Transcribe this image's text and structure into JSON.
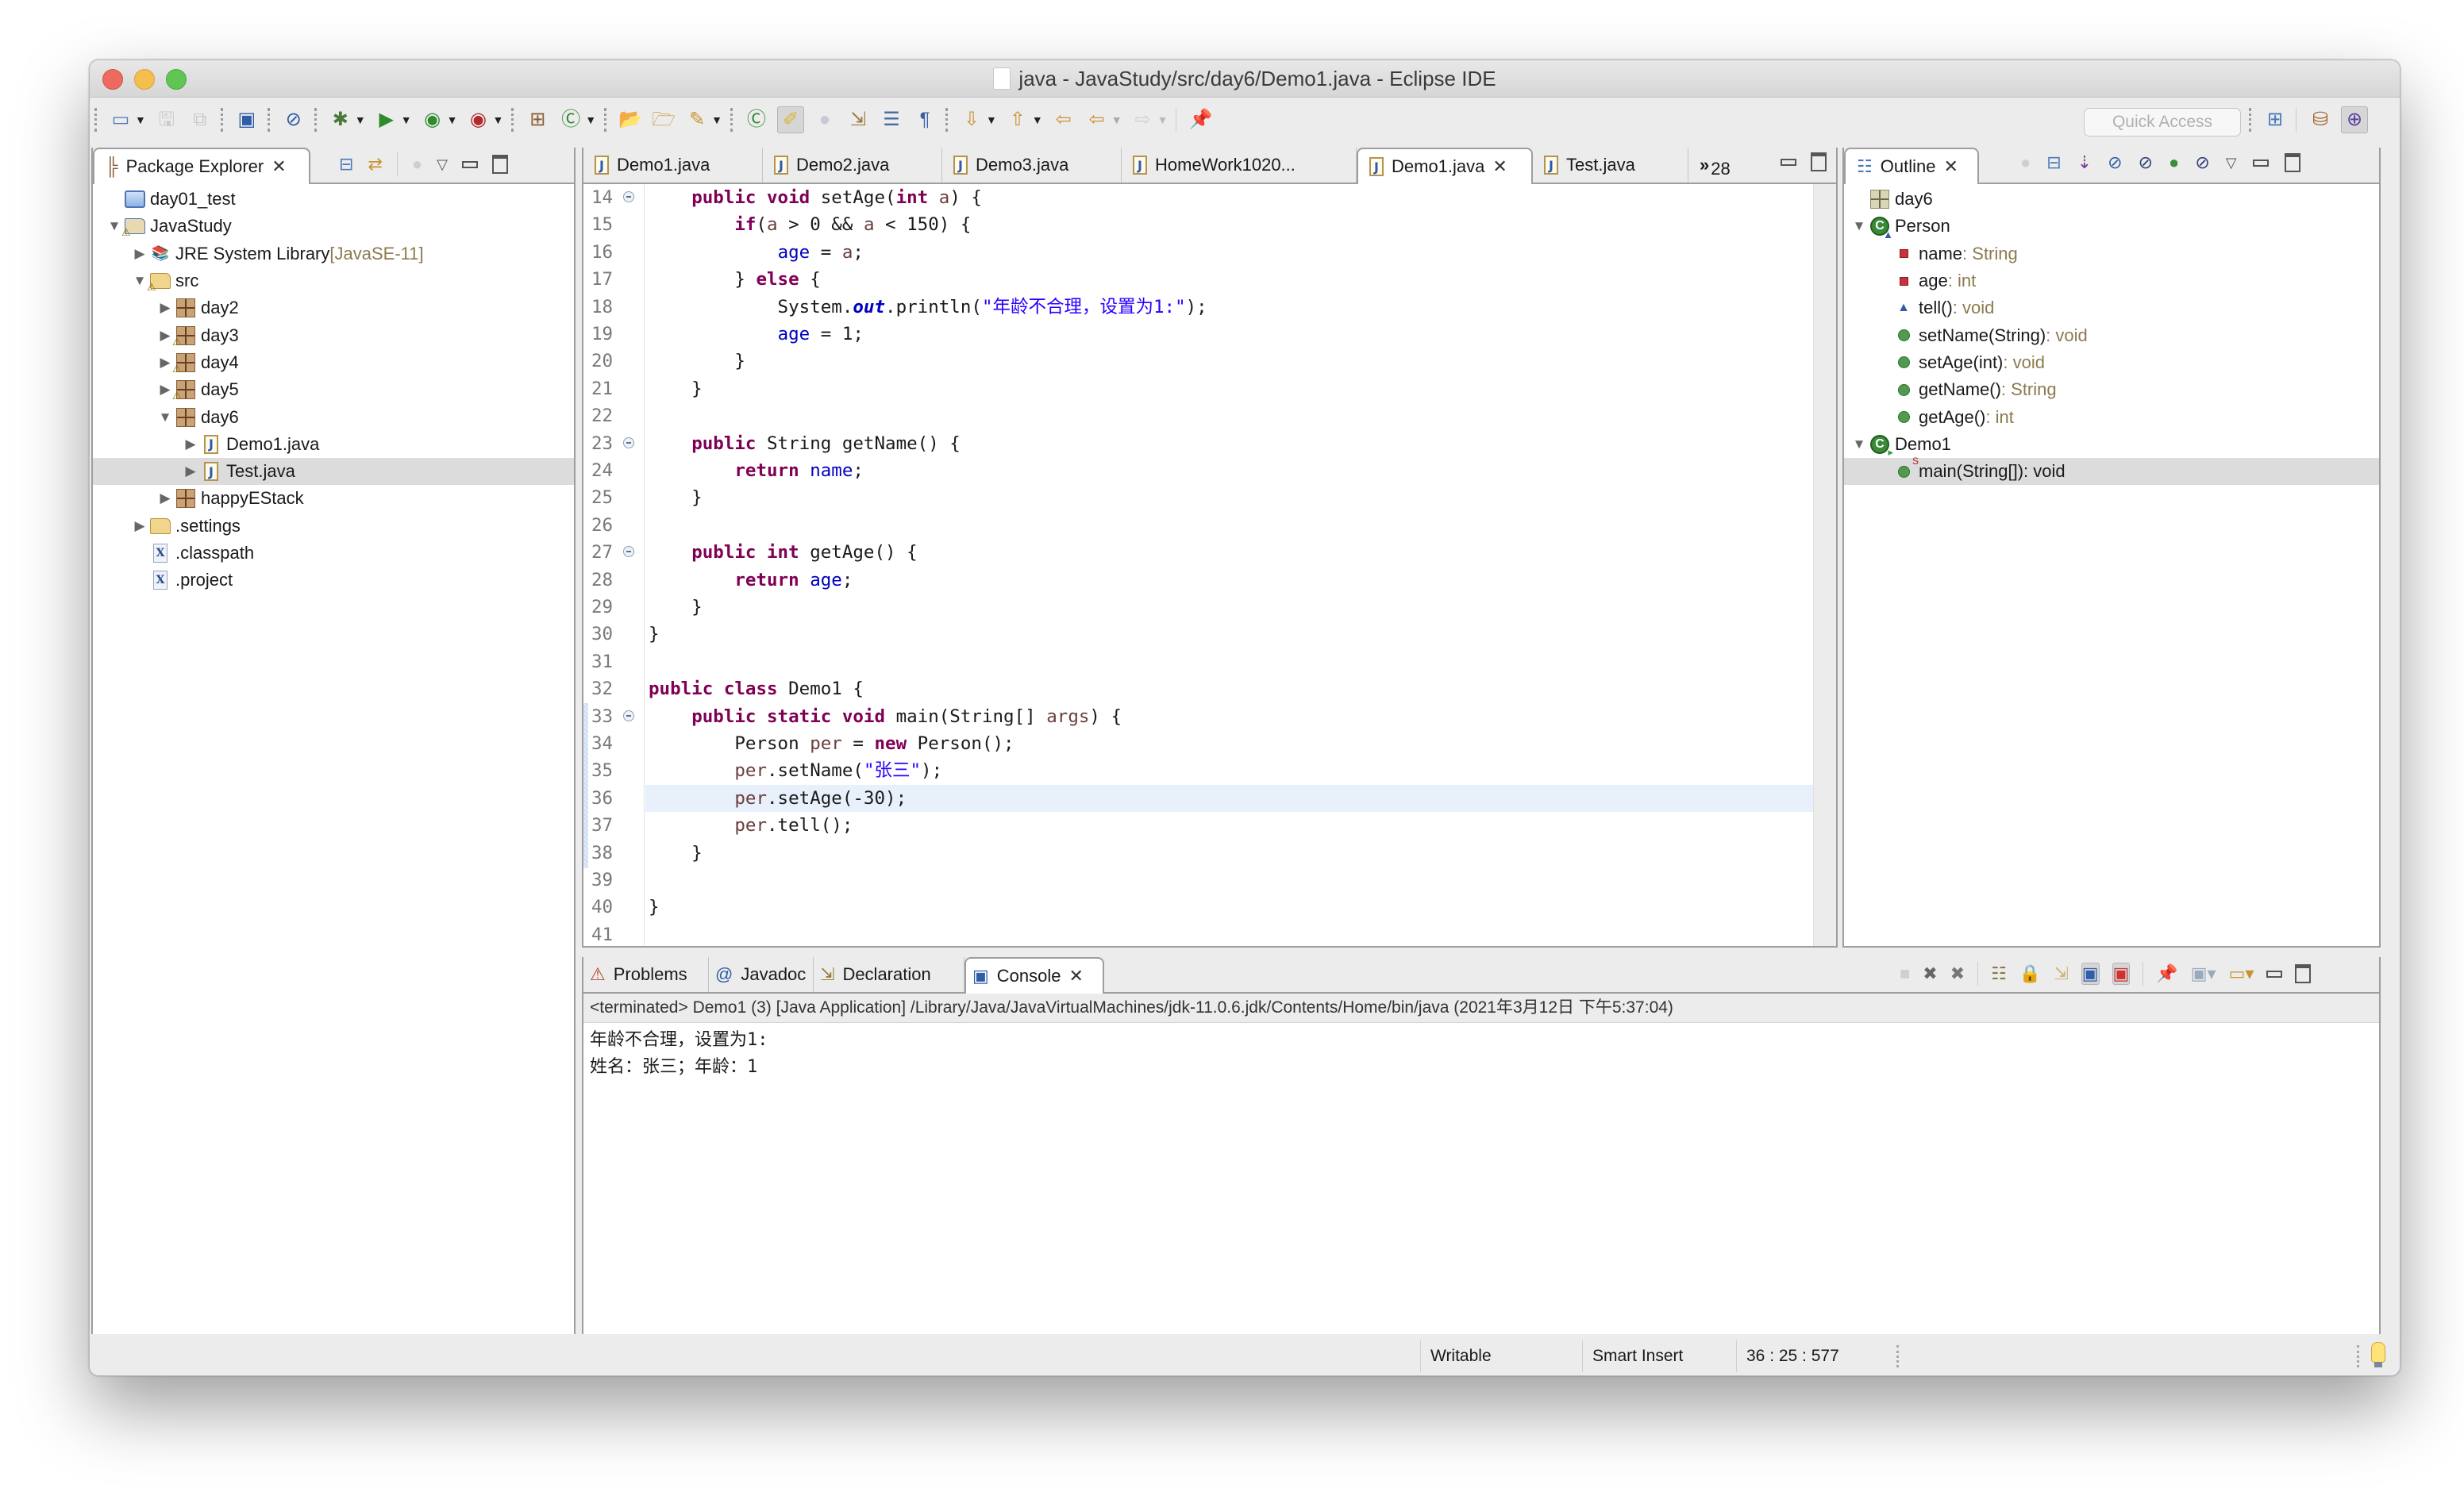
{
  "window": {
    "title": "java - JavaStudy/src/day6/Demo1.java - Eclipse IDE"
  },
  "toolbar": {
    "icons": [
      "new-wizard-icon",
      "save-icon",
      "save-all-icon",
      "console-icon",
      "skip-breakpoints-icon",
      "debug-icon",
      "run-icon",
      "coverage-icon",
      "external-tools-icon",
      "new-package-icon",
      "new-class-icon",
      "open-type-icon",
      "open-task-icon",
      "search-icon",
      "open-perspective-class-icon",
      "toggle-mark-occurrences-icon",
      "toggle-ws-icon",
      "toggle-block-icon",
      "show-whitespace-icon",
      "next-annotation-icon",
      "previous-annotation-icon",
      "last-edit-icon",
      "back-icon",
      "forward-icon",
      "pin-editor-icon"
    ],
    "quick_access_placeholder": "Quick Access",
    "perspectives": [
      "open-perspective-icon",
      "java-ee-perspective-icon",
      "java-perspective-icon"
    ]
  },
  "package_explorer": {
    "tab_label": "Package Explorer",
    "items": [
      {
        "label": "day01_test",
        "icon": "closed-project-icon",
        "depth": 0,
        "expander": "none"
      },
      {
        "label": "JavaStudy",
        "icon": "java-project-icon",
        "depth": 0,
        "expander": "expanded",
        "warning": true
      },
      {
        "label": "JRE System Library",
        "decoration": "[JavaSE-11]",
        "icon": "library-icon",
        "depth": 1,
        "expander": "collapsed"
      },
      {
        "label": "src",
        "icon": "source-folder-icon",
        "depth": 1,
        "expander": "expanded",
        "warning": true
      },
      {
        "label": "day2",
        "icon": "package-icon",
        "depth": 2,
        "expander": "collapsed"
      },
      {
        "label": "day3",
        "icon": "package-icon",
        "depth": 2,
        "expander": "collapsed",
        "warning": true
      },
      {
        "label": "day4",
        "icon": "package-icon",
        "depth": 2,
        "expander": "collapsed",
        "warning": true
      },
      {
        "label": "day5",
        "icon": "package-icon",
        "depth": 2,
        "expander": "collapsed",
        "warning": true
      },
      {
        "label": "day6",
        "icon": "package-icon",
        "depth": 2,
        "expander": "expanded"
      },
      {
        "label": "Demo1.java",
        "icon": "java-file-icon",
        "depth": 3,
        "expander": "collapsed"
      },
      {
        "label": "Test.java",
        "icon": "java-file-icon",
        "depth": 3,
        "expander": "collapsed",
        "selected": true
      },
      {
        "label": "happyEStack",
        "icon": "package-icon",
        "depth": 2,
        "expander": "collapsed"
      },
      {
        "label": ".settings",
        "icon": "folder-icon",
        "depth": 1,
        "expander": "collapsed"
      },
      {
        "label": ".classpath",
        "icon": "xml-file-icon",
        "depth": 1,
        "expander": "none"
      },
      {
        "label": ".project",
        "icon": "xml-file-icon",
        "depth": 1,
        "expander": "none"
      }
    ]
  },
  "editor": {
    "tabs": [
      {
        "label": "Demo1.java"
      },
      {
        "label": "Demo2.java"
      },
      {
        "label": "Demo3.java"
      },
      {
        "label": "HomeWork1020..."
      },
      {
        "label": "Demo1.java",
        "active": true
      },
      {
        "label": "Test.java"
      }
    ],
    "overflow_count": "28",
    "current_line": 36,
    "lines": [
      {
        "n": "14",
        "fold": true,
        "tokens": [
          [
            "",
            "    "
          ],
          [
            "k",
            "public"
          ],
          [
            "",
            " "
          ],
          [
            "k",
            "void"
          ],
          [
            "",
            " setAge("
          ],
          [
            "k",
            "int"
          ],
          [
            "",
            " "
          ],
          [
            "lv",
            "a"
          ],
          [
            "",
            ") {"
          ]
        ]
      },
      {
        "n": "15",
        "tokens": [
          [
            "",
            "        "
          ],
          [
            "k",
            "if"
          ],
          [
            "",
            "("
          ],
          [
            "lv",
            "a"
          ],
          [
            "",
            " > 0 && "
          ],
          [
            "lv",
            "a"
          ],
          [
            "",
            " < 150) {"
          ]
        ]
      },
      {
        "n": "16",
        "tokens": [
          [
            "",
            "            "
          ],
          [
            "f",
            "age"
          ],
          [
            "",
            " = "
          ],
          [
            "lv",
            "a"
          ],
          [
            "",
            ";"
          ]
        ]
      },
      {
        "n": "17",
        "tokens": [
          [
            "",
            "        } "
          ],
          [
            "k",
            "else"
          ],
          [
            "",
            " {"
          ]
        ]
      },
      {
        "n": "18",
        "tokens": [
          [
            "",
            "            System."
          ],
          [
            "fs",
            "out"
          ],
          [
            "",
            ".println("
          ],
          [
            "s",
            "\"年龄不合理，设置为1:\""
          ],
          [
            "",
            ");"
          ]
        ]
      },
      {
        "n": "19",
        "tokens": [
          [
            "",
            "            "
          ],
          [
            "f",
            "age"
          ],
          [
            "",
            " = 1;"
          ]
        ]
      },
      {
        "n": "20",
        "tokens": [
          [
            "",
            "        }"
          ]
        ]
      },
      {
        "n": "21",
        "tokens": [
          [
            "",
            "    }"
          ]
        ]
      },
      {
        "n": "22",
        "tokens": []
      },
      {
        "n": "23",
        "fold": true,
        "tokens": [
          [
            "",
            "    "
          ],
          [
            "k",
            "public"
          ],
          [
            "",
            " String getName() {"
          ]
        ]
      },
      {
        "n": "24",
        "tokens": [
          [
            "",
            "        "
          ],
          [
            "k",
            "return"
          ],
          [
            "",
            " "
          ],
          [
            "f",
            "name"
          ],
          [
            "",
            ";"
          ]
        ]
      },
      {
        "n": "25",
        "tokens": [
          [
            "",
            "    }"
          ]
        ]
      },
      {
        "n": "26",
        "tokens": []
      },
      {
        "n": "27",
        "fold": true,
        "tokens": [
          [
            "",
            "    "
          ],
          [
            "k",
            "public"
          ],
          [
            "",
            " "
          ],
          [
            "k",
            "int"
          ],
          [
            "",
            " getAge() {"
          ]
        ]
      },
      {
        "n": "28",
        "tokens": [
          [
            "",
            "        "
          ],
          [
            "k",
            "return"
          ],
          [
            "",
            " "
          ],
          [
            "f",
            "age"
          ],
          [
            "",
            ";"
          ]
        ]
      },
      {
        "n": "29",
        "tokens": [
          [
            "",
            "    }"
          ]
        ]
      },
      {
        "n": "30",
        "tokens": [
          [
            "",
            "}"
          ]
        ]
      },
      {
        "n": "31",
        "tokens": []
      },
      {
        "n": "32",
        "tokens": [
          [
            "k",
            "public"
          ],
          [
            "",
            " "
          ],
          [
            "k",
            "class"
          ],
          [
            "",
            " Demo1 {"
          ]
        ]
      },
      {
        "n": "33",
        "fold": true,
        "tokens": [
          [
            "",
            "    "
          ],
          [
            "k",
            "public"
          ],
          [
            "",
            " "
          ],
          [
            "k",
            "static"
          ],
          [
            "",
            " "
          ],
          [
            "k",
            "void"
          ],
          [
            "",
            " main(String[] "
          ],
          [
            "lv",
            "args"
          ],
          [
            "",
            ") {"
          ]
        ]
      },
      {
        "n": "34",
        "tokens": [
          [
            "",
            "        Person "
          ],
          [
            "lv",
            "per"
          ],
          [
            "",
            " = "
          ],
          [
            "k",
            "new"
          ],
          [
            "",
            " Person();"
          ]
        ]
      },
      {
        "n": "35",
        "tokens": [
          [
            "",
            "        "
          ],
          [
            "lv",
            "per"
          ],
          [
            "",
            ".setName("
          ],
          [
            "s",
            "\"张三\""
          ],
          [
            "",
            ");"
          ]
        ]
      },
      {
        "n": "36",
        "tokens": [
          [
            "",
            "        "
          ],
          [
            "lv",
            "per"
          ],
          [
            "",
            ".setAge(-30);"
          ]
        ]
      },
      {
        "n": "37",
        "tokens": [
          [
            "",
            "        "
          ],
          [
            "lv",
            "per"
          ],
          [
            "",
            ".tell();"
          ]
        ]
      },
      {
        "n": "38",
        "tokens": [
          [
            "",
            "    }"
          ]
        ]
      },
      {
        "n": "39",
        "tokens": []
      },
      {
        "n": "40",
        "tokens": [
          [
            "",
            "}"
          ]
        ]
      },
      {
        "n": "41",
        "tokens": []
      }
    ]
  },
  "outline": {
    "tab_label": "Outline",
    "items": [
      {
        "label": "day6",
        "type": "",
        "icon": "package-icon",
        "depth": 0,
        "expander": "none"
      },
      {
        "label": "Person",
        "type": "",
        "icon": "class-default-icon",
        "depth": 0,
        "expander": "expanded"
      },
      {
        "label": "name",
        "type": " : String",
        "icon": "private-field-icon",
        "depth": 1
      },
      {
        "label": "age",
        "type": " : int",
        "icon": "private-field-icon",
        "depth": 1
      },
      {
        "label": "tell()",
        "type": " : void",
        "icon": "default-method-icon",
        "depth": 1
      },
      {
        "label": "setName(String)",
        "type": " : void",
        "icon": "public-method-icon",
        "depth": 1
      },
      {
        "label": "setAge(int)",
        "type": " : void",
        "icon": "public-method-icon",
        "depth": 1
      },
      {
        "label": "getName()",
        "type": " : String",
        "icon": "public-method-icon",
        "depth": 1
      },
      {
        "label": "getAge()",
        "type": " : int",
        "icon": "public-method-icon",
        "depth": 1
      },
      {
        "label": "Demo1",
        "type": "",
        "icon": "class-runnable-icon",
        "depth": 0,
        "expander": "expanded"
      },
      {
        "label": "main(String[])",
        "type": " : void",
        "icon": "static-public-method-icon",
        "depth": 1,
        "selected": true
      }
    ]
  },
  "bottom": {
    "tabs": [
      {
        "label": "Problems",
        "icon": "problems-icon"
      },
      {
        "label": "Javadoc",
        "icon": "javadoc-icon"
      },
      {
        "label": "Declaration",
        "icon": "declaration-icon"
      },
      {
        "label": "Console",
        "icon": "console-icon",
        "active": true
      }
    ],
    "console_header": "<terminated> Demo1 (3) [Java Application] /Library/Java/JavaVirtualMachines/jdk-11.0.6.jdk/Contents/Home/bin/java (2021年3月12日 下午5:37:04)",
    "console_output": [
      "年龄不合理，设置为1:",
      "姓名：张三；年龄：1"
    ]
  },
  "status_bar": {
    "writable": "Writable",
    "insert_mode": "Smart Insert",
    "position": "36 : 25 : 577"
  },
  "colors": {
    "keyword": "#7f0055",
    "field": "#0000c0",
    "string": "#2a00ff",
    "local_var": "#6a3e3e",
    "current_line": "#e8f0fc",
    "selection": "#dcdcdc",
    "decoration": "#8c7a4f"
  }
}
